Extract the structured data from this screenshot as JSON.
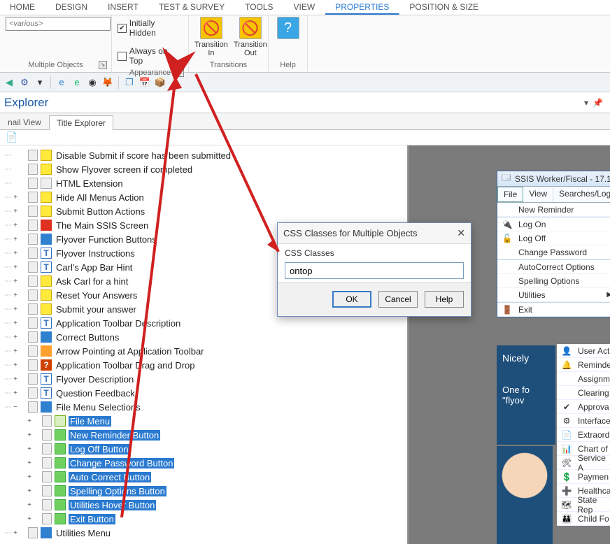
{
  "ribbon": {
    "tabs": [
      "HOME",
      "DESIGN",
      "INSERT",
      "TEST & SURVEY",
      "TOOLS",
      "VIEW",
      "PROPERTIES",
      "POSITION & SIZE"
    ],
    "active_index": 6,
    "groups": {
      "multiple_objects": {
        "label": "Multiple Objects",
        "input_placeholder": "<various>"
      },
      "appearance": {
        "label": "Appearance",
        "initially_hidden": {
          "label": "Initially Hidden",
          "checked": true
        },
        "always_on_top": {
          "label": "Always on Top",
          "checked": false
        }
      },
      "transitions": {
        "label": "Transitions",
        "in_label": "Transition In",
        "out_label": "Transition Out"
      },
      "help": {
        "label": "Help"
      }
    }
  },
  "explorer": {
    "title": "Explorer",
    "tabs": {
      "thumbnail": "nail View",
      "title_explorer": "Title Explorer"
    },
    "tree": [
      {
        "lvl": 0,
        "exp": "",
        "ico": "ic-action",
        "label": "Disable Submit if score has been submitted"
      },
      {
        "lvl": 0,
        "exp": "",
        "ico": "ic-action",
        "label": "Show Flyover screen if completed"
      },
      {
        "lvl": 0,
        "exp": "",
        "ico": "ic-page",
        "label": "HTML Extension"
      },
      {
        "lvl": 0,
        "exp": "+",
        "ico": "ic-action",
        "label": "Hide All Menus Action"
      },
      {
        "lvl": 0,
        "exp": "+",
        "ico": "ic-action",
        "label": "Submit Button Actions"
      },
      {
        "lvl": 0,
        "exp": "+",
        "ico": "ic-red",
        "label": "The Main SSIS Screen"
      },
      {
        "lvl": 0,
        "exp": "+",
        "ico": "ic-blue",
        "label": "Flyover Function Buttons"
      },
      {
        "lvl": 0,
        "exp": "+",
        "ico": "ic-text",
        "label": "Flyover Instructions"
      },
      {
        "lvl": 0,
        "exp": "+",
        "ico": "ic-text",
        "label": "Carl's App Bar Hint"
      },
      {
        "lvl": 0,
        "exp": "+",
        "ico": "ic-action",
        "label": "Ask Carl for a hint"
      },
      {
        "lvl": 0,
        "exp": "+",
        "ico": "ic-action",
        "label": "Reset Your Answers"
      },
      {
        "lvl": 0,
        "exp": "+",
        "ico": "ic-action",
        "label": "Submit your answer"
      },
      {
        "lvl": 0,
        "exp": "+",
        "ico": "ic-text",
        "label": "Application Toolbar Description"
      },
      {
        "lvl": 0,
        "exp": "+",
        "ico": "ic-blue",
        "label": "Correct Buttons"
      },
      {
        "lvl": 0,
        "exp": "+",
        "ico": "ic-arrow",
        "label": "Arrow Pointing at Application Toolbar"
      },
      {
        "lvl": 0,
        "exp": "+",
        "ico": "ic-q",
        "label": "Application Toolbar Drag and Drop"
      },
      {
        "lvl": 0,
        "exp": "+",
        "ico": "ic-text",
        "label": "Flyover Description"
      },
      {
        "lvl": 0,
        "exp": "+",
        "ico": "ic-text",
        "label": "Question Feedback"
      },
      {
        "lvl": 0,
        "exp": "−",
        "ico": "ic-blue",
        "label": "File Menu Selections"
      },
      {
        "lvl": 1,
        "exp": "+",
        "ico": "ic-img",
        "label": "File Menu",
        "sel": true
      },
      {
        "lvl": 1,
        "exp": "+",
        "ico": "ic-btn",
        "label": "New Reminder Button",
        "sel": true
      },
      {
        "lvl": 1,
        "exp": "+",
        "ico": "ic-btn",
        "label": "Log Off Button",
        "sel": true
      },
      {
        "lvl": 1,
        "exp": "+",
        "ico": "ic-btn",
        "label": "Change Password Button",
        "sel": true
      },
      {
        "lvl": 1,
        "exp": "+",
        "ico": "ic-btn",
        "label": "Auto Correct Button",
        "sel": true
      },
      {
        "lvl": 1,
        "exp": "+",
        "ico": "ic-btn",
        "label": "Spelling Options Button",
        "sel": true
      },
      {
        "lvl": 1,
        "exp": "+",
        "ico": "ic-btn",
        "label": "Utilities Hover Button",
        "sel": true
      },
      {
        "lvl": 1,
        "exp": "+",
        "ico": "ic-btn",
        "label": "Exit Button",
        "sel": true
      },
      {
        "lvl": 0,
        "exp": "+",
        "ico": "ic-blue",
        "label": "Utilities Menu"
      }
    ]
  },
  "dialog": {
    "title": "CSS Classes for Multiple Objects",
    "field_label": "CSS Classes",
    "value": "ontop",
    "ok": "OK",
    "cancel": "Cancel",
    "help": "Help"
  },
  "ssis": {
    "window_title": "SSIS Worker/Fiscal - 17.1",
    "menubar": [
      "File",
      "View",
      "Searches/Log"
    ],
    "file_menu": [
      {
        "icon": "",
        "label": "New Reminder"
      },
      {
        "sep": true
      },
      {
        "icon": "🔌",
        "label": "Log On"
      },
      {
        "icon": "🔓",
        "label": "Log Off"
      },
      {
        "icon": "",
        "label": "Change Password"
      },
      {
        "sep": true
      },
      {
        "icon": "",
        "label": "AutoCorrect Options"
      },
      {
        "icon": "",
        "label": "Spelling Options"
      },
      {
        "icon": "",
        "label": "Utilities",
        "submenu": true
      },
      {
        "sep": true
      },
      {
        "icon": "🚪",
        "label": "Exit"
      }
    ],
    "blue_panel": {
      "line1": "Nicely",
      "line2a": "One fo",
      "line2b": "\"flyov"
    },
    "side_list": [
      {
        "icon": "👤",
        "label": "User Act"
      },
      {
        "icon": "🔔",
        "label": "Reminde"
      },
      {
        "icon": "",
        "label": "Assignm"
      },
      {
        "icon": "",
        "label": "Clearing"
      },
      {
        "icon": "✔",
        "label": "Approva"
      },
      {
        "icon": "⚙",
        "label": "Interface"
      },
      {
        "icon": "📄",
        "label": "Extraord"
      },
      {
        "icon": "📊",
        "label": "Chart of"
      },
      {
        "icon": "🛠",
        "label": "Service A"
      },
      {
        "icon": "💲",
        "label": "Paymen"
      },
      {
        "icon": "➕",
        "label": "Healthca"
      },
      {
        "icon": "🗺",
        "label": "State Rep"
      },
      {
        "icon": "👪",
        "label": "Child Fo"
      }
    ]
  }
}
